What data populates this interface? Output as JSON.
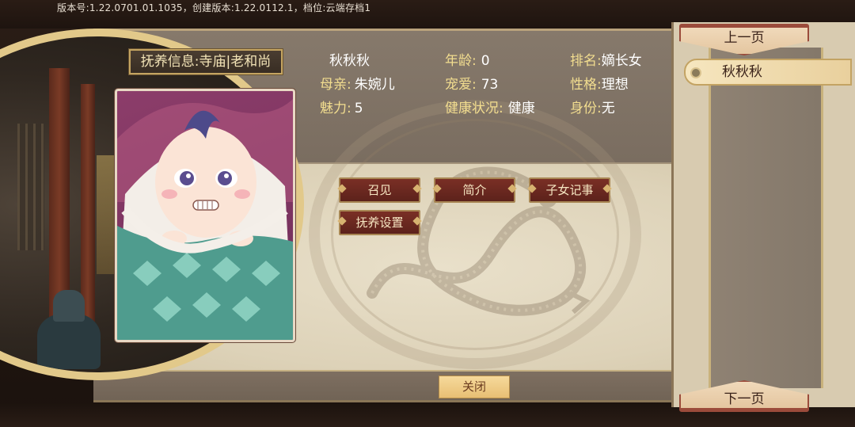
{
  "header": {
    "version_text": "版本号:1.22.0701.01.1035，创建版本:1.22.0112.1，档位:云端存档1"
  },
  "tab": {
    "label": "抚养信息:寺庙|老和尚"
  },
  "child": {
    "name": "秋秋秋",
    "age_label": "年龄:",
    "age_value": "0",
    "rank_label": "排名:",
    "rank_value": "嫡长女",
    "mother_label": "母亲:",
    "mother_value": "朱婉儿",
    "favor_label": "宠爱:",
    "favor_value": "73",
    "personality_label": "性格:",
    "personality_value": "理想",
    "charm_label": "魅力:",
    "charm_value": "5",
    "health_label": "健康状况:",
    "health_value": "健康",
    "status_label": "身份:",
    "status_value": "无"
  },
  "actions": {
    "summon": "召见",
    "intro": "简介",
    "records": "子女记事",
    "upbringing": "抚养设置",
    "close": "关闭"
  },
  "sidebar": {
    "prev_page": "上一页",
    "next_page": "下一页",
    "items": [
      {
        "label": "秋秋秋",
        "selected": true
      }
    ]
  },
  "colors": {
    "gold_text": "#f2dd8f",
    "button_red": "#6a261e",
    "parchment": "#e6dcc4",
    "frame_gold": "#e2c98a"
  }
}
